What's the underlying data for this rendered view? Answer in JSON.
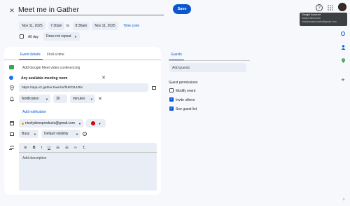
{
  "header": {
    "title": "Meet me in Gather",
    "save_label": "Save"
  },
  "datetime": {
    "start_date": "Nov 11, 2025",
    "start_time": "7:30am",
    "to_label": "to",
    "end_time": "8:30am",
    "end_date": "Nov 11, 2025",
    "timezone_label": "Time zone"
  },
  "options": {
    "allday_label": "All day",
    "repeat_label": "Does not repeat"
  },
  "tabs": [
    {
      "label": "Event details"
    },
    {
      "label": "Find a time"
    }
  ],
  "details": {
    "meet_label": "Add Google Meet video conferencing",
    "room_label": "Any available meeting room",
    "location_value": "https://app.v2.gather.town/m/f49O3L1Rtx",
    "notification_type": "Notification",
    "notification_value": "30",
    "notification_unit": "minutes",
    "add_notification_label": "Add notification",
    "calendar_owner": "nicelydoneproducts@gmail.com",
    "busy_label": "Busy",
    "visibility_label": "Default visibility",
    "description_placeholder": "Add description"
  },
  "guests": {
    "tab_label": "Guests",
    "add_placeholder": "Add guests",
    "permissions_label": "Guest permissions",
    "perm_modify": "Modify event",
    "perm_invite": "Invite others",
    "perm_see": "See guest list",
    "perm_modify_checked": false,
    "perm_invite_checked": true,
    "perm_see_checked": true
  },
  "account_tooltip": {
    "title": "Google Account",
    "name": "Rachel Brancobo",
    "email": "nicelydoneproducts@gmail.com"
  },
  "colors": {
    "accent": "#0b57d0",
    "event_color": "#d50000"
  }
}
